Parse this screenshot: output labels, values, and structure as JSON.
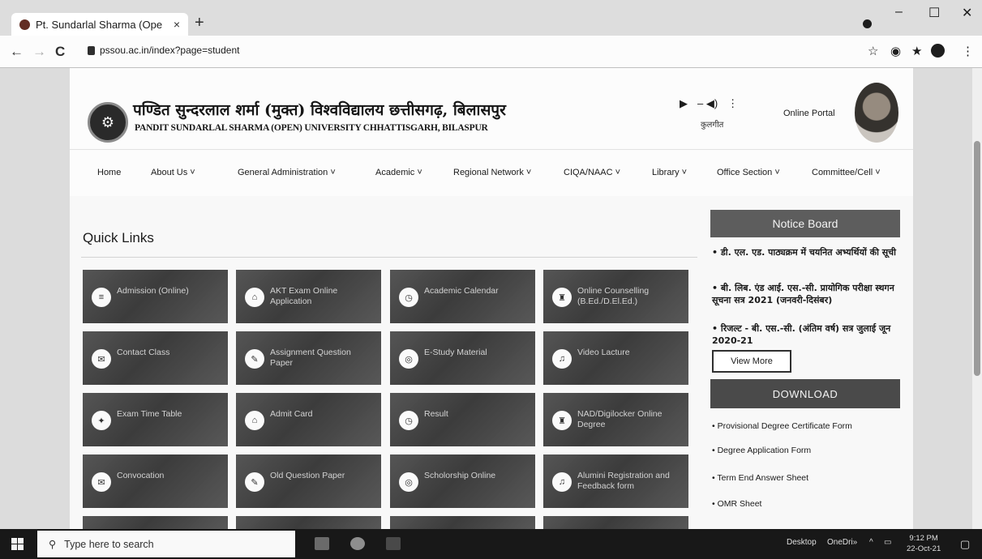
{
  "browser": {
    "tab_title": "Pt. Sundarlal Sharma (Ope",
    "tab_close": "×",
    "new_tab": "+",
    "url": "pssou.ac.in/index?page=student",
    "minimize": "–",
    "maximize": "☐",
    "close": "✕"
  },
  "header": {
    "university_hindi": "पण्डित सुन्दरलाल शर्मा (मुक्त) विश्वविद्यालय छत्तीसगढ़, बिलासपुर",
    "university_english": "PANDIT SUNDARLAL SHARMA (OPEN) UNIVERSITY CHHATTISGARH, BILASPUR",
    "kulgeet": "कुलगीत",
    "online_portal": "Online Portal"
  },
  "nav": [
    "Home",
    "About Us ˅",
    "General Administration ˅",
    "Academic ˅",
    "Regional Network ˅",
    "CIQA/NAAC ˅",
    "Library ˅",
    "Office Section ˅",
    "Committee/Cell ˅"
  ],
  "quick_links": {
    "title": "Quick Links",
    "tiles": [
      {
        "label": "Admission (Online)",
        "icon": "≡"
      },
      {
        "label": "AKT Exam Online Application",
        "icon": "⌂"
      },
      {
        "label": "Academic Calendar",
        "icon": "◷"
      },
      {
        "label": "Online Counselling (B.Ed./D.El.Ed.)",
        "icon": "♜"
      },
      {
        "label": "Contact Class",
        "icon": "✉"
      },
      {
        "label": "Assignment Question Paper",
        "icon": "✎"
      },
      {
        "label": "E-Study Material",
        "icon": "◎"
      },
      {
        "label": "Video Lacture",
        "icon": "♫"
      },
      {
        "label": "Exam Time Table",
        "icon": "✦"
      },
      {
        "label": "Admit Card",
        "icon": "⌂"
      },
      {
        "label": "Result",
        "icon": "◷"
      },
      {
        "label": "NAD/Digilocker Online Degree",
        "icon": "♜"
      },
      {
        "label": "Convocation",
        "icon": "✉"
      },
      {
        "label": "Old Question Paper",
        "icon": "✎"
      },
      {
        "label": "Scholorship Online",
        "icon": "◎"
      },
      {
        "label": "Alumini Registration and Feedback form",
        "icon": "♫"
      }
    ]
  },
  "notice_board": {
    "title": "Notice Board",
    "items": [
      "• डी. एल. एड. पाठ्यक्रम में चयनित अभ्यर्थियों की सूची",
      "• बी. लिब. एंड आई. एस.-सी. प्रायोगिक परीक्षा स्थगन सूचना सत्र 2021 (जनवरी-दिसंबर)",
      "• रिजल्ट - बी. एस.-सी. (अंतिम वर्ष) सत्र जुलाई जून 2020-21"
    ],
    "view_more": "View More"
  },
  "download": {
    "title": "DOWNLOAD",
    "items": [
      "• Provisional Degree Certificate Form",
      "• Degree Application Form",
      "• Term End Answer Sheet",
      "• OMR Sheet"
    ]
  },
  "taskbar": {
    "search_placeholder": "Type here to search",
    "desktop": "Desktop",
    "onedrive": "OneDri»",
    "time": "9:12 PM",
    "date": "22-Oct-21"
  }
}
